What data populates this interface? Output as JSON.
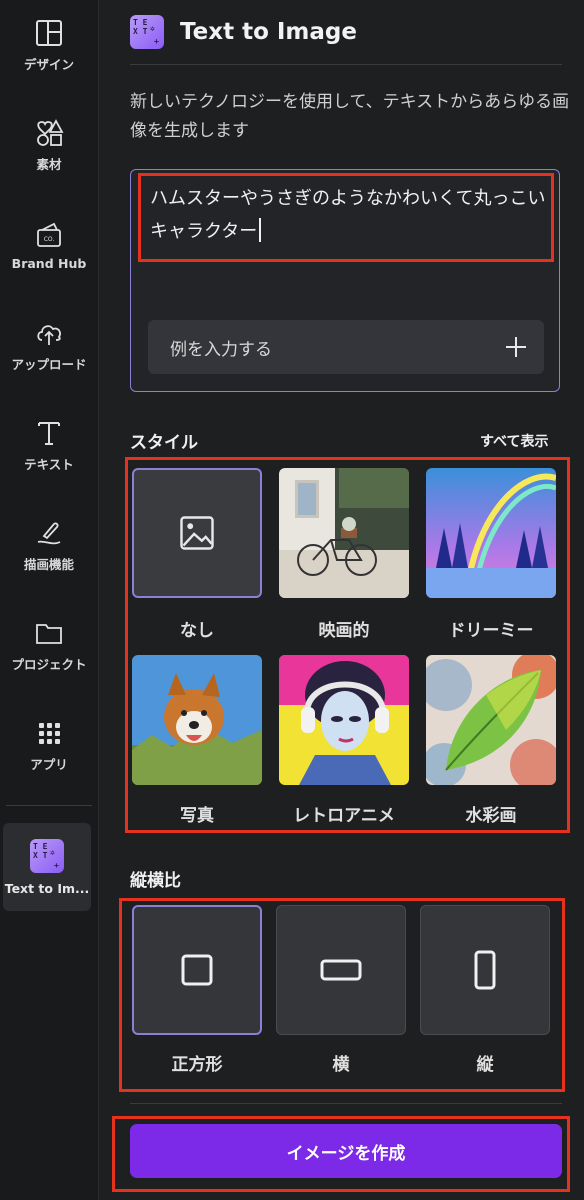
{
  "sidebar": {
    "items": [
      {
        "label": "デザイン",
        "icon": "layout-icon"
      },
      {
        "label": "素材",
        "icon": "elements-icon"
      },
      {
        "label": "Brand Hub",
        "icon": "brand-hub-icon"
      },
      {
        "label": "アップロード",
        "icon": "upload-cloud-icon"
      },
      {
        "label": "テキスト",
        "icon": "text-icon"
      },
      {
        "label": "描画機能",
        "icon": "draw-icon"
      },
      {
        "label": "プロジェクト",
        "icon": "folder-icon"
      },
      {
        "label": "アプリ",
        "icon": "apps-grid-icon"
      }
    ],
    "active": {
      "label": "Text to Im...",
      "icon": "text-to-image-icon"
    }
  },
  "header": {
    "title": "Text to Image"
  },
  "description": "新しいテクノロジーを使用して、テキストからあらゆる画像を生成します",
  "prompt": {
    "value": "ハムスターやうさぎのようなかわいくて丸っこいキャラクター",
    "example_button": "例を入力する"
  },
  "styles": {
    "title": "スタイル",
    "see_all": "すべて表示",
    "items": [
      {
        "label": "なし",
        "selected": true
      },
      {
        "label": "映画的"
      },
      {
        "label": "ドリーミー"
      },
      {
        "label": "写真"
      },
      {
        "label": "レトロアニメ"
      },
      {
        "label": "水彩画"
      }
    ]
  },
  "aspect": {
    "title": "縦横比",
    "items": [
      {
        "label": "正方形",
        "selected": true
      },
      {
        "label": "横"
      },
      {
        "label": "縦"
      }
    ]
  },
  "create_button": "イメージを作成",
  "colors": {
    "accent": "#7d2ae8",
    "selected_border": "#8b7fd6",
    "highlight": "#e5321f"
  }
}
